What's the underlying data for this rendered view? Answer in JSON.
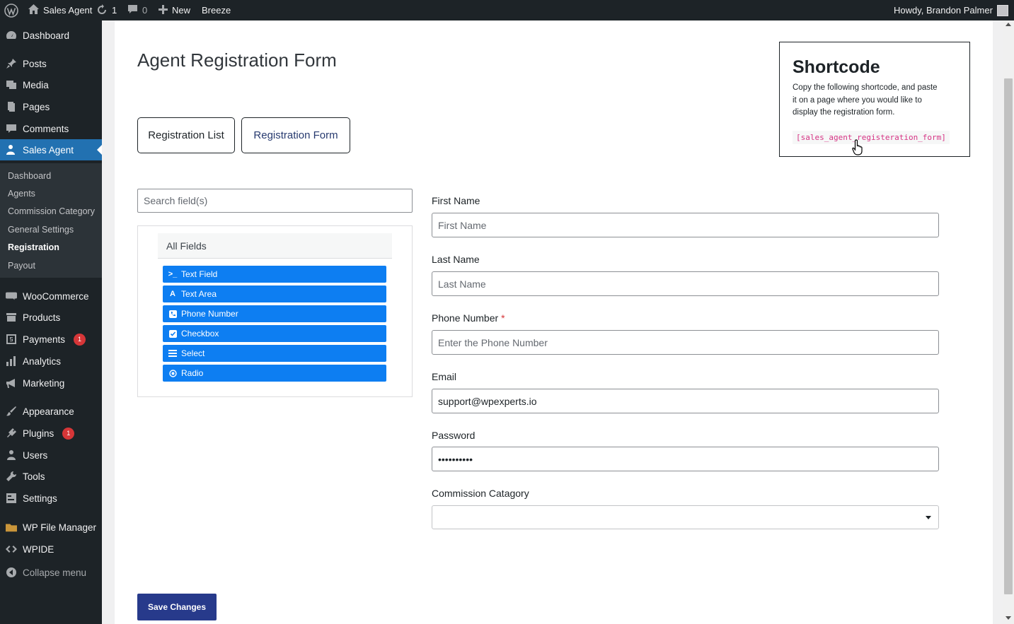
{
  "admin_bar": {
    "site_name": "Sales Agent",
    "updates_count": "1",
    "comments_count": "0",
    "new_label": "New",
    "breeze_label": "Breeze",
    "greeting": "Howdy, Brandon Palmer"
  },
  "sidebar": {
    "items": {
      "dashboard": "Dashboard",
      "posts": "Posts",
      "media": "Media",
      "pages": "Pages",
      "comments": "Comments",
      "sales_agent": "Sales Agent",
      "woocommerce": "WooCommerce",
      "products": "Products",
      "payments": "Payments",
      "analytics": "Analytics",
      "marketing": "Marketing",
      "appearance": "Appearance",
      "plugins": "Plugins",
      "users": "Users",
      "tools": "Tools",
      "settings": "Settings",
      "wp_file_manager": "WP File Manager",
      "wpide": "WPIDE",
      "collapse": "Collapse menu"
    },
    "badges": {
      "payments": "1",
      "plugins": "1"
    },
    "submenu": {
      "dashboard": "Dashboard",
      "agents": "Agents",
      "commission_category": "Commission Category",
      "general_settings": "General Settings",
      "registration": "Registration",
      "payout": "Payout"
    }
  },
  "main": {
    "title": "Agent Registration Form",
    "tabs": {
      "list": "Registration List",
      "form": "Registration Form"
    },
    "shortcode": {
      "title": "Shortcode",
      "description": "Copy the following shortcode, and paste it on a page where you would like to display the registration form.",
      "code": "[sales_agent_registeration_form]"
    },
    "search": {
      "placeholder": "Search field(s)"
    },
    "fields_panel": {
      "header": "All Fields",
      "items": {
        "text_field": "Text Field",
        "text_area": "Text Area",
        "phone_number": "Phone Number",
        "checkbox": "Checkbox",
        "select": "Select",
        "radio": "Radio"
      }
    },
    "form": {
      "first_name": {
        "label": "First Name",
        "placeholder": "First Name",
        "value": ""
      },
      "last_name": {
        "label": "Last Name",
        "placeholder": "Last Name",
        "value": ""
      },
      "phone": {
        "label": "Phone Number",
        "required": "*",
        "placeholder": "Enter the Phone Number",
        "value": ""
      },
      "email": {
        "label": "Email",
        "value": "support@wpexperts.io"
      },
      "password": {
        "label": "Password",
        "value": "••••••••••"
      },
      "commission": {
        "label": "Commission Catagory",
        "value": ""
      }
    },
    "save_label": "Save Changes"
  },
  "colors": {
    "admin_bg": "#1d2327",
    "active_menu": "#2271b1",
    "field_button": "#0d7ef2",
    "save_button": "#273a8b",
    "badge": "#d63638"
  }
}
